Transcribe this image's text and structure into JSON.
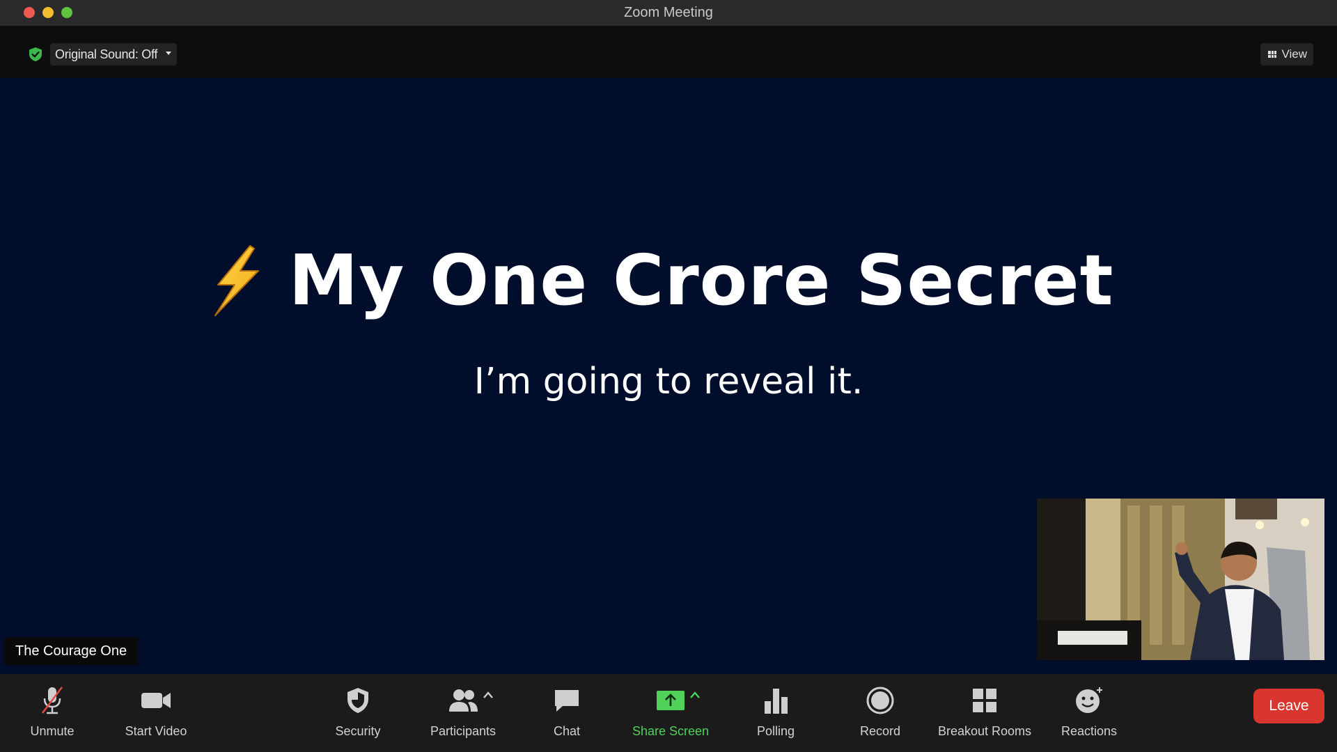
{
  "window": {
    "title": "Zoom Meeting"
  },
  "topbar": {
    "sound_label": "Original Sound: Off",
    "view_label": "View"
  },
  "slide": {
    "headline": "My One Crore Secret",
    "subline": "I’m going to reveal it."
  },
  "participant": {
    "name": "The Courage One"
  },
  "toolbar": {
    "unmute": "Unmute",
    "start_video": "Start Video",
    "security": "Security",
    "participants": "Participants",
    "chat": "Chat",
    "share_screen": "Share Screen",
    "polling": "Polling",
    "record": "Record",
    "breakout_rooms": "Breakout Rooms",
    "reactions": "Reactions",
    "leave": "Leave"
  },
  "colors": {
    "stage": "#000e2b",
    "share_green": "#4fd15a",
    "leave_red": "#d9362f",
    "toolbar": "#1b1b1b"
  }
}
